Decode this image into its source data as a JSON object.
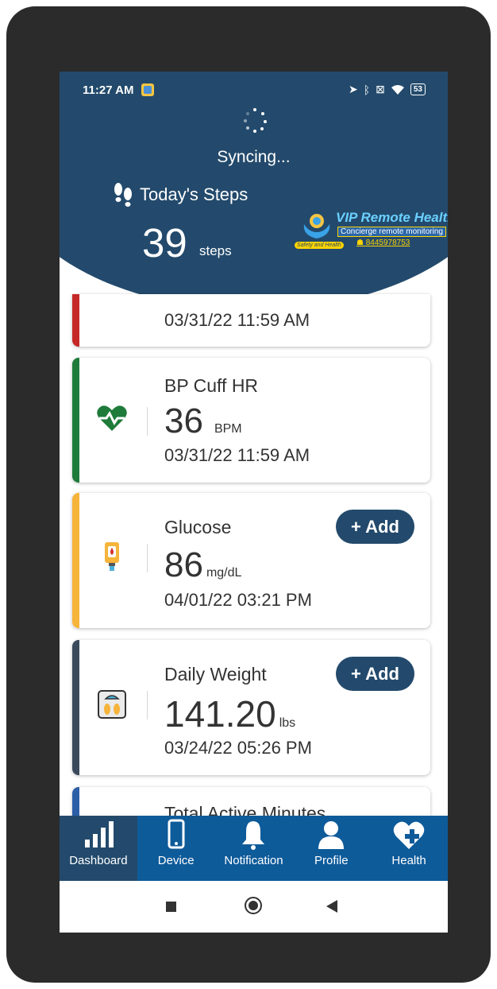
{
  "status_bar": {
    "time": "11:27 AM",
    "battery": "53"
  },
  "sync": {
    "text": "Syncing..."
  },
  "steps": {
    "title": "Today's Steps",
    "value": "39",
    "unit": "steps"
  },
  "logo": {
    "name": "VIP Remote Health",
    "tagline": "Concierge remote monitoring",
    "phone": "8445978753",
    "badge": "Safety and Health"
  },
  "cards": {
    "partial_top": {
      "date": "03/31/22 11:59 AM",
      "accent": "#c62828"
    },
    "bp_hr": {
      "title": "BP Cuff HR",
      "value": "36",
      "unit": "BPM",
      "date": "03/31/22 11:59 AM",
      "accent": "#1e7b3a",
      "icon": "heart-pulse-icon"
    },
    "glucose": {
      "title": "Glucose",
      "value": "86",
      "unit": "mg/dL",
      "date": "04/01/22 03:21 PM",
      "accent": "#f6b43b",
      "icon": "glucometer-icon",
      "add_label": "+ Add"
    },
    "weight": {
      "title": "Daily Weight",
      "value": "141.20",
      "unit": "lbs",
      "date": "03/24/22 05:26 PM",
      "accent": "#3a4a5c",
      "icon": "scale-icon",
      "add_label": "+ Add"
    },
    "active_minutes": {
      "title": "Total Active Minutes",
      "accent": "#2c5ea8"
    }
  },
  "bottom_nav": [
    {
      "label": "Dashboard",
      "icon": "bar-chart-icon",
      "active": true
    },
    {
      "label": "Device",
      "icon": "phone-icon",
      "active": false
    },
    {
      "label": "Notification",
      "icon": "bell-icon",
      "active": false
    },
    {
      "label": "Profile",
      "icon": "person-icon",
      "active": false
    },
    {
      "label": "Health",
      "icon": "heart-plus-icon",
      "active": false
    }
  ],
  "colors": {
    "primary": "#234a6c",
    "nav": "#0e5b9a",
    "accent_yellow": "#ffd400"
  }
}
